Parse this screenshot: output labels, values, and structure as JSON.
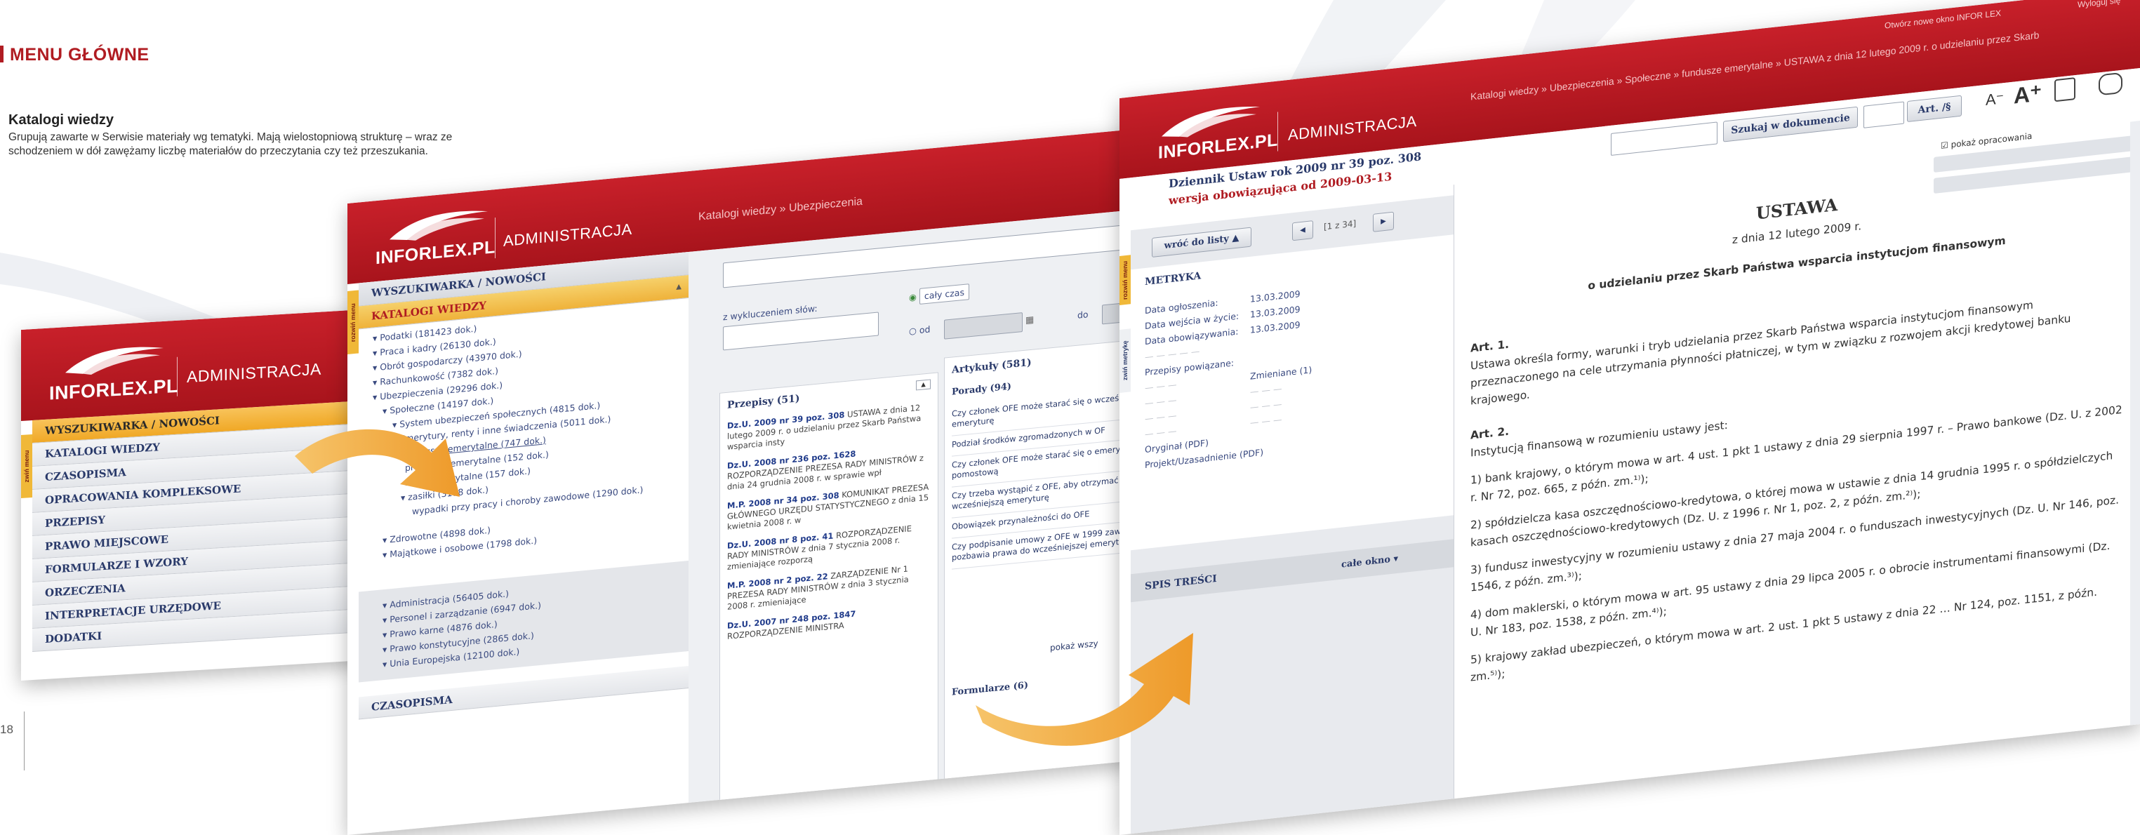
{
  "page": {
    "section_header": "MENU GŁÓWNE",
    "subsection_title": "Katalogi wiedzy",
    "subsection_description": "Grupują zawarte w Serwisie materiały wg tematyki. Mają wielostopniową strukturę – wraz ze schodzeniem w dół zawężamy liczbę materiałów do przeczytania czy też przeszukania.",
    "page_number": "18",
    "brand_red": "#b01c22",
    "arrow_color": "#f2a23a"
  },
  "brand": {
    "logo": "INFORLEX.PL",
    "product": "ADMINISTRACJA"
  },
  "shot1": {
    "side_tab": "zwiń menu",
    "menu_items": [
      "WYSZUKIWARKA / NOWOŚCI",
      "KATALOGI WIEDZY",
      "CZASOPISMA",
      "OPRACOWANIA KOMPLEKSOWE",
      "PRZEPISY",
      "PRAWO MIEJSCOWE",
      "FORMULARZE I WZORY",
      "ORZECZENIA",
      "INTERPRETACJE URZĘDOWE",
      "DODATKI"
    ]
  },
  "shot2": {
    "breadcrumb": "Katalogi wiedzy » Ubezpieczenia",
    "side_tab": "rozwiń menu",
    "menu_top": "WYSZUKIWARKA / NOWOŚCI",
    "menu_active": "KATALOGI WIEDZY",
    "tree": [
      "▾ Podatki (181423 dok.)",
      "▾ Praca i kadry (26130 dok.)",
      "▾ Obrót gospodarczy (43970 dok.)",
      "▾ Rachunkowość (7382 dok.)",
      "▾ Ubezpieczenia (29296 dok.)",
      "▾ Społeczne (14197 dok.)",
      "▾ System ubezpieczeń społecznych (4815 dok.)",
      "▾ Emerytury, renty i inne świadczenia (5011 dok.)",
      "fundusze emerytalne (747 dok.)",
      "programy emerytalne (152 dok.)",
      "konta emerytalne (157 dok.)",
      "▾ zasiłki (3188 dok.)",
      "wypadki przy pracy i choroby zawodowe (1290 dok.)",
      "▾ Zdrowotne (4898 dok.)",
      "▾ Majątkowe i osobowe (1798 dok.)",
      "▾ Administracja (56405 dok.)",
      "▾ Personel i zarządzanie (6947 dok.)",
      "▾ Prawo karne (4876 dok.)",
      "▾ Prawo konstytucyjne (2865 dok.)",
      "▾ Unia Europejska (12100 dok.)",
      "CZASOPISMA"
    ],
    "exclude_label": "z wykluczeniem słów:",
    "time_all": "cały czas",
    "time_from": "od",
    "time_to": "do",
    "przepisy_header": "Przepisy (51)",
    "przepisy": [
      {
        "t": "Dz.U. 2009 nr 39 poz. 308",
        "d": "USTAWA z dnia 12 lutego 2009 r. o udzielaniu przez Skarb Państwa wsparcia insty"
      },
      {
        "t": "Dz.U. 2008 nr 236 poz. 1628",
        "d": "ROZPORZĄDZENIE PREZESA RADY MINISTRÓW z dnia 24 grudnia 2008 r. w sprawie wpł"
      },
      {
        "t": "M.P. 2008 nr 34 poz. 308",
        "d": "KOMUNIKAT PREZESA GŁÓWNEGO URZĘDU STATYSTYCZNEGO z dnia 15 kwietnia 2008 r. w"
      },
      {
        "t": "Dz.U. 2008 nr 8 poz. 41",
        "d": "ROZPORZĄDZENIE RADY MINISTRÓW z dnia 7 stycznia 2008 r. zmieniające rozporzą"
      },
      {
        "t": "M.P. 2008 nr 2 poz. 22",
        "d": "ZARZĄDZENIE Nr 1 PREZESA RADY MINISTRÓW z dnia 3 stycznia 2008 r. zmieniające"
      },
      {
        "t": "Dz.U. 2007 nr 248 poz. 1847",
        "d": "ROZPORZĄDZENIE MINISTRA"
      }
    ],
    "artykuly_header": "Artykuły (581)",
    "porady_header": "Porady (94)",
    "porady": [
      "Czy członek OFE może starać się o wcześniejszą emeryturę",
      "Podział środków zgromadzonych w OF",
      "Czy członek OFE może starać się o emeryturę pomostową",
      "Czy trzeba wystąpić z OFE, aby otrzymać wcześniejszą emeryturę",
      "Obowiązek przynależności do OFE",
      "Czy podpisanie umowy z OFE w 1999 zawsze pozbawia prawa do wcześniejszej emerytury"
    ],
    "show_all": "pokaż wszy",
    "formularze": "Formularze (6)"
  },
  "shot3": {
    "top_links": [
      "Otwórz nowe okno INFOR LEX",
      "Wyloguj się"
    ],
    "breadcrumb": "Katalogi wiedzy » Ubezpieczenia » Społeczne » fundusze emerytalne » USTAWA z dnia 12 lutego 2009 r. o udzielaniu przez Skarb",
    "search_btn": "Szukaj w dokumencie",
    "art_btn": "Art. /§",
    "font_small": "A⁻",
    "font_big": "A⁺",
    "show_annotations": "pokaż opracowania",
    "journal_title": "Dziennik Ustaw rok 2009 nr 39 poz. 308",
    "version": "wersja obowiązująca od 2009-03-13",
    "back_btn": "wróć do listy",
    "pager": "[1 z 34]",
    "side_tab_1": "rozwiń menu",
    "side_tab_2": "zwiń metrykę",
    "metryka_header": "METRYKA",
    "metryka": [
      {
        "k": "Data ogłoszenia:",
        "v": "13.03.2009"
      },
      {
        "k": "Data wejścia w życie:",
        "v": "13.03.2009"
      },
      {
        "k": "Data obowiązywania:",
        "v": "13.03.2009"
      }
    ],
    "powiazane": "Przepisy powiązane:",
    "zmieniane": "Zmieniane (1)",
    "oryginal": "Oryginał (PDF)",
    "projekt": "Projekt/Uzasadnienie (PDF)",
    "spis": "SPIS TREŚCI",
    "cale_okno": "całe okno",
    "doc_title": "USTAWA",
    "doc_date": "z dnia 12 lutego 2009 r.",
    "doc_subject": "o udzielaniu przez Skarb Państwa wsparcia instytucjom finansowym",
    "art1": "Art. 1.",
    "art1_text": "Ustawa określa formy, warunki i tryb udzielania przez Skarb Państwa wsparcia instytucjom finansowym przeznaczonego na cele utrzymania płynności płatniczej, w tym w związku z rozwojem akcji kredytowej banku krajowego.",
    "art2": "Art. 2.",
    "art2_intro": "Instytucją finansową w rozumieniu ustawy jest:",
    "points": [
      "1) bank krajowy, o którym mowa w art. 4 ust. 1 pkt 1 ustawy z dnia 29 sierpnia 1997 r. – Prawo bankowe (Dz. U. z 2002 r. Nr 72, poz. 665, z późn. zm.¹⁾);",
      "2) spółdzielcza kasa oszczędnościowo-kredytowa, o której mowa w ustawie z dnia 14 grudnia 1995 r. o spółdzielczych kasach oszczędnościowo-kredytowych (Dz. U. z 1996 r. Nr 1, poz. 2, z późn. zm.²⁾);",
      "3) fundusz inwestycyjny w rozumieniu ustawy z dnia 27 maja 2004 r. o funduszach inwestycyjnych (Dz. U. Nr 146, poz. 1546, z późn. zm.³⁾);",
      "4) dom maklerski, o którym mowa w art. 95 ustawy z dnia 29 lipca 2005 r. o obrocie instrumentami finansowymi (Dz. U. Nr 183, poz. 1538, z późn. zm.⁴⁾);",
      "5) krajowy zakład ubezpieczeń, o którym mowa w art. 2 ust. 1 pkt 5 ustawy z dnia 22 … Nr 124, poz. 1151, z późn. zm.⁵⁾);"
    ]
  }
}
